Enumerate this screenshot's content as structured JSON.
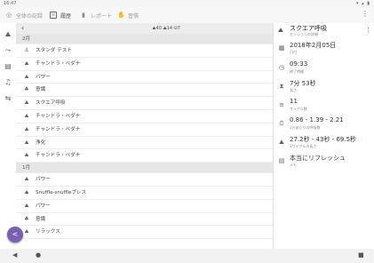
{
  "status_bar": {
    "time": "16:47",
    "icons": "▾ ▴ ▮"
  },
  "app_bar": {
    "tabs": [
      {
        "label": "全体の記録",
        "icon": "history-icon"
      },
      {
        "label": "履歴",
        "icon": "list-icon"
      },
      {
        "label": "レポート",
        "icon": "chart-icon"
      },
      {
        "label": "習慣",
        "icon": "habit-icon"
      }
    ],
    "menu": "⋮"
  },
  "toolbar": {
    "back": "‹",
    "stats": "⛰40  ⛰14  ⛁7"
  },
  "list": [
    {
      "type": "header",
      "label": "2月"
    },
    {
      "type": "item",
      "label": "スタンダ テスト",
      "icon": "⚓"
    },
    {
      "type": "item",
      "label": "チャンドラ・ベダナ",
      "icon": "⛰"
    },
    {
      "type": "item",
      "label": "パワー",
      "icon": "⛰"
    },
    {
      "type": "item",
      "label": "意識",
      "icon": "♣"
    },
    {
      "type": "item",
      "label": "スクエア呼吸",
      "icon": "⛰"
    },
    {
      "type": "item",
      "label": "チャンドラ・ベダナ",
      "icon": "⛰"
    },
    {
      "type": "item",
      "label": "チャンドラ・ベダナ",
      "icon": "⛰"
    },
    {
      "type": "item",
      "label": "浄化",
      "icon": "⛰"
    },
    {
      "type": "item",
      "label": "チャンドラ・ベダナ",
      "icon": "⛰"
    },
    {
      "type": "header",
      "label": "1月"
    },
    {
      "type": "item",
      "label": "パワー",
      "icon": "⛰"
    },
    {
      "type": "item",
      "label": "Snuffle-snuffleブレス",
      "icon": "⛰"
    },
    {
      "type": "item",
      "label": "パワー",
      "icon": "⛰"
    },
    {
      "type": "item",
      "label": "意識",
      "icon": "♣"
    },
    {
      "type": "item",
      "label": "リラックス",
      "icon": "⛰"
    }
  ],
  "detail": {
    "title": "スクエア呼吸",
    "subtitle": "セッションの詳細",
    "menu": "⋮",
    "rows": [
      {
        "icon": "▦",
        "value": "2018年2月05日",
        "caption": "日付"
      },
      {
        "icon": "◷",
        "value": "09:33",
        "caption": "終了時間"
      },
      {
        "icon": "⧗",
        "value": "7分 53秒",
        "caption": "長さ"
      },
      {
        "icon": "≡",
        "value": "11",
        "caption": "サイクル数"
      },
      {
        "icon": "⏱",
        "value": "0.86 - 1.39 - 2.21",
        "caption": "1分あたりの呼吸数"
      },
      {
        "icon": "⛰",
        "value": "27.2秒 - 43秒 - 69.5秒",
        "caption": "1サイクルの長さ"
      },
      {
        "icon": "▤",
        "value": "本当にリフレッシュ",
        "caption": "メモ"
      }
    ]
  },
  "fab": {
    "icon": "share-icon"
  },
  "nav_bar": {
    "back": "◀",
    "home": "●",
    "recents": "■"
  },
  "colors": {
    "accent": "#7b5fb0",
    "header_bg": "#e6e6e6"
  }
}
